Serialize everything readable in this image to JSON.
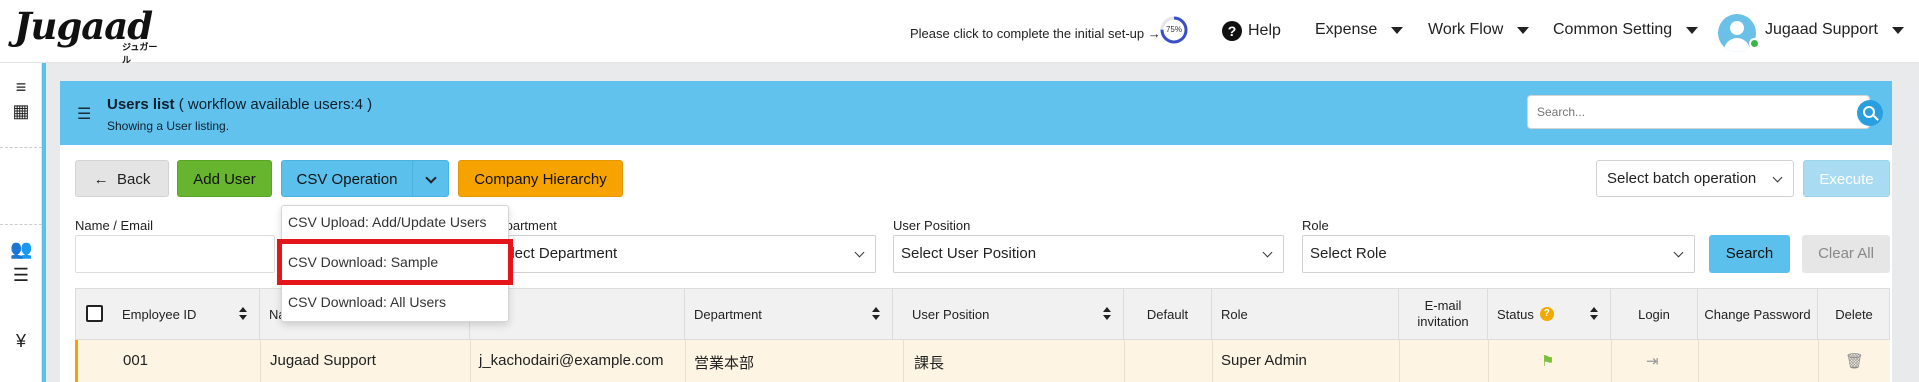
{
  "header": {
    "logo_word": "Jugaad",
    "logo_kana": "ジュガール",
    "setup_text": "Please click to complete the initial set-up →",
    "setup_progress": 75,
    "setup_progress_label": "75%",
    "help_label": "Help",
    "nav": [
      {
        "label": "Expense"
      },
      {
        "label": "Work Flow"
      },
      {
        "label": "Common Setting"
      }
    ],
    "user_name": "Jugaad Support"
  },
  "panel": {
    "title": "Users list",
    "title_note": "( workflow available users:4 )",
    "subtitle": "Showing a User listing.",
    "search_placeholder": "Search..."
  },
  "toolbar": {
    "back_label": "Back",
    "add_user_label": "Add User",
    "csv_operation_label": "CSV Operation",
    "company_hierarchy_label": "Company Hierarchy",
    "batch_select_label": "Select batch operation",
    "execute_label": "Execute"
  },
  "csv_menu": [
    {
      "label": "CSV Upload: Add/Update Users"
    },
    {
      "label": "CSV Download: Sample"
    },
    {
      "label": "CSV Download: All Users"
    }
  ],
  "filters": {
    "name_email_label": "Name / Email",
    "department_label": "Department",
    "department_select": "Select Department",
    "position_label": "User Position",
    "position_select": "Select User Position",
    "role_label": "Role",
    "role_select": "Select Role",
    "search_label": "Search",
    "clear_label": "Clear All"
  },
  "table": {
    "columns": [
      "Employee ID",
      "Name",
      "",
      "Department",
      "User Position",
      "Default",
      "Role",
      "E-mail invitation",
      "Status",
      "Login",
      "Change Password",
      "Delete"
    ],
    "rows": [
      {
        "employee_id": "001",
        "name": "Jugaad Support",
        "email": "j_kachodairi@example.com",
        "department": "営業本部",
        "position": "課長",
        "default": "",
        "role": "Super Admin"
      }
    ]
  },
  "colors": {
    "accent_blue": "#5bc0eb",
    "green": "#67b52f",
    "orange": "#f6a300",
    "highlight_red": "#e4161b"
  }
}
